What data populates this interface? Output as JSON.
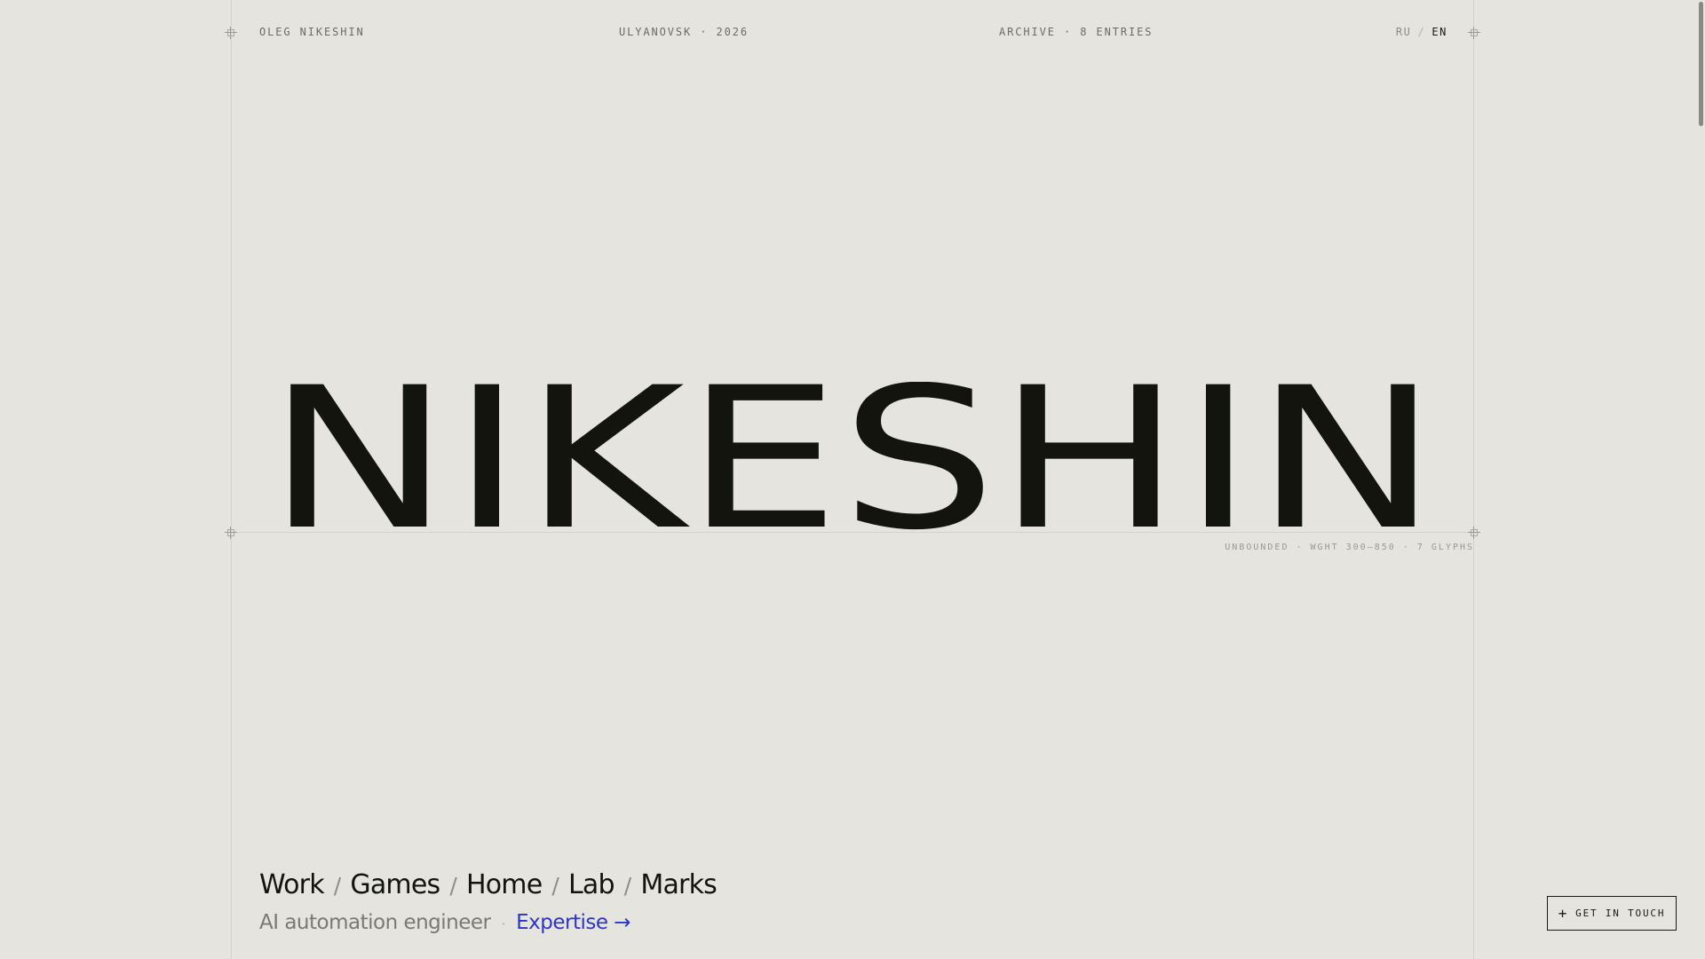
{
  "header": {
    "name": "OLEG NIKESHIN",
    "location": "ULYANOVSK · 2026",
    "archive": "ARCHIVE · 8 ENTRIES",
    "lang_ru": "RU",
    "lang_sep": "/",
    "lang_en": "EN"
  },
  "hero": {
    "title": "NIKESHIN",
    "meta": "UNBOUNDED · WGHT 300–850 · 7 GLYPHS"
  },
  "nav": {
    "items": [
      "Work",
      "Games",
      "Home",
      "Lab",
      "Marks"
    ],
    "separator": "/"
  },
  "subline": {
    "role": "AI automation engineer",
    "dot": "·",
    "link": "Expertise →"
  },
  "cta": {
    "label": "GET IN TOUCH",
    "icon": "plus-icon"
  },
  "colors": {
    "background": "#e5e4de",
    "ink": "#14140f",
    "accent": "#2c35c8"
  }
}
